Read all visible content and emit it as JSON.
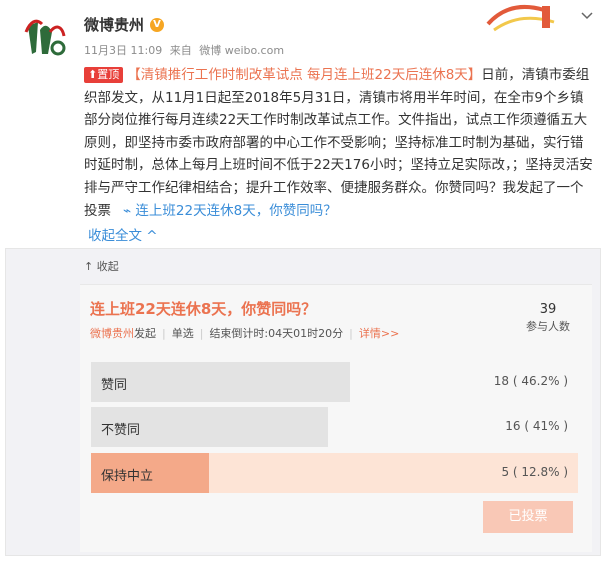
{
  "header": {
    "author": "微博贵州",
    "verified_icon": "verified-badge-icon",
    "date": "11月3日 11:09",
    "source_prefix": "来自",
    "source": "微博 weibo.com",
    "menu_icon": "chevron-down-icon"
  },
  "post": {
    "pin_label": "置顶",
    "topic": "【清镇推行工作时制改革试点 每月连上班22天后连休8天】",
    "body": "日前，清镇市委组织部发文，从11月1日起至2018年5月31日，清镇市将用半年时间，在全市9个乡镇部分岗位推行每月连续22天工作时制改革试点工作。文件指出，试点工作须遵循五大原则，即坚持市委市政府部署的中心工作不受影响；坚持标准工时制为基础，实行错时延时制，总体上每月上班时间不低于22天176小时；坚持立足实际改，；坚持灵活安排与严守工作纪律相结合；提升工作效率、便捷服务群众。你赞同吗？我发起了一个投票",
    "vote_link": "连上班22天连休8天，你赞同吗？",
    "collapse_label": "收起全文 ^"
  },
  "poll": {
    "collapse_label": "收起",
    "title": "连上班22天连休8天，你赞同吗？",
    "participants": "39",
    "participants_label": "参与人数",
    "creator": "微博贵州",
    "creator_suffix": "发起",
    "type": "单选",
    "countdown": "结束倒计时:04天01时20分",
    "detail_label": "详情>>",
    "options": [
      {
        "label": "赞同",
        "result": "18 ( 46.2% )",
        "percent": 46.2,
        "selected": false
      },
      {
        "label": "不赞同",
        "result": "16 ( 41% )",
        "percent": 41,
        "selected": false
      },
      {
        "label": "保持中立",
        "result": "5 ( 12.8% )",
        "percent": 12.8,
        "selected": true
      }
    ],
    "voted_label": "已投票"
  },
  "colors": {
    "accent": "#eb7350",
    "link": "#3a8dd8",
    "pin": "#e83f39"
  }
}
